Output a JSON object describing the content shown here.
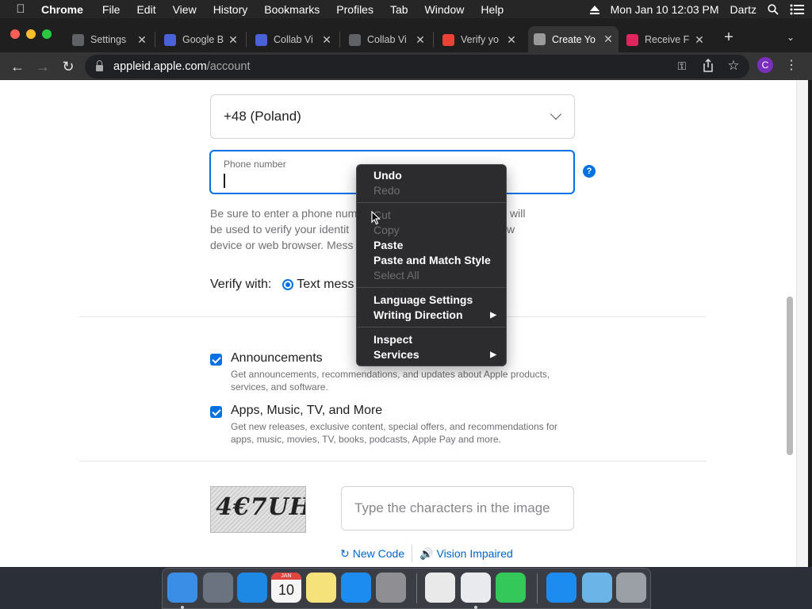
{
  "menubar": {
    "app": "Chrome",
    "items": [
      "File",
      "Edit",
      "View",
      "History",
      "Bookmarks",
      "Profiles",
      "Tab",
      "Window",
      "Help"
    ],
    "datetime": "Mon Jan 10  12:03 PM",
    "user": "Dartz"
  },
  "tabs": [
    {
      "title": "Settings",
      "icon": "gear-icon",
      "color": "#5f6368"
    },
    {
      "title": "Google B",
      "icon": "google-forms-icon",
      "color": "#4a62d8"
    },
    {
      "title": "Collab Vi",
      "icon": "google-forms-icon",
      "color": "#4a62d8"
    },
    {
      "title": "Collab Vi",
      "icon": "globe-icon",
      "color": "#5f6368"
    },
    {
      "title": "Verify yo",
      "icon": "gmail-icon",
      "color": "#ea4335"
    },
    {
      "title": "Create Yo",
      "icon": "apple-icon",
      "color": "#9a9a9a",
      "active": true
    },
    {
      "title": "Receive F",
      "icon": "receive-sms-icon",
      "color": "#e0245e"
    }
  ],
  "address": {
    "domain": "appleid.apple.com",
    "path": "/account"
  },
  "profile_initial": "C",
  "form": {
    "country": "+48 (Poland)",
    "phone_label": "Phone number",
    "help": "?",
    "hint_parts": [
      "Be sure to enter a phone num",
      "will",
      "be used to verify your identit",
      "w",
      "device or web browser. Mess"
    ],
    "verify_label": "Verify with:",
    "verify_option": "Text mess"
  },
  "options": [
    {
      "title": "Announcements",
      "desc": "Get announcements, recommendations, and updates about Apple products, services, and software.",
      "checked": true
    },
    {
      "title": "Apps, Music, TV, and More",
      "desc": "Get new releases, exclusive content, special offers, and recommendations for apps, music, movies, TV, books, podcasts, Apple Pay and more.",
      "checked": true
    }
  ],
  "captcha": {
    "image_text": "4€7UH",
    "placeholder": "Type the characters in the image",
    "new_code": "New Code",
    "vision_impaired": "Vision Impaired"
  },
  "context_menu": {
    "groups": [
      [
        {
          "label": "Undo",
          "enabled": true
        },
        {
          "label": "Redo",
          "enabled": false
        }
      ],
      [
        {
          "label": "Cut",
          "enabled": false
        },
        {
          "label": "Copy",
          "enabled": false
        },
        {
          "label": "Paste",
          "enabled": true
        },
        {
          "label": "Paste and Match Style",
          "enabled": true
        },
        {
          "label": "Select All",
          "enabled": false
        }
      ],
      [
        {
          "label": "Language Settings",
          "enabled": true
        },
        {
          "label": "Writing Direction",
          "enabled": true,
          "submenu": true
        }
      ],
      [
        {
          "label": "Inspect",
          "enabled": true
        },
        {
          "label": "Services",
          "enabled": true,
          "submenu": true
        }
      ]
    ]
  },
  "dock": [
    {
      "name": "finder-icon",
      "color": "#3a8ee6",
      "running": true
    },
    {
      "name": "launchpad-icon",
      "color": "#6b7280"
    },
    {
      "name": "safari-icon",
      "color": "#1e88e5"
    },
    {
      "name": "calendar-icon",
      "color": "#f5f5f5",
      "text": "10",
      "sub": "JAN"
    },
    {
      "name": "notes-icon",
      "color": "#f6e27a"
    },
    {
      "name": "app-store-icon",
      "color": "#1c8cf0"
    },
    {
      "name": "system-preferences-icon",
      "color": "#8e8e93"
    },
    {
      "name": "preview-icon",
      "color": "#e9e9e9"
    },
    {
      "name": "chrome-icon",
      "color": "#e8eaed",
      "running": true
    },
    {
      "name": "facetime-icon",
      "color": "#34c759"
    },
    {
      "name": "app-store-downloads-icon",
      "color": "#1c8cf0"
    },
    {
      "name": "folder-icon",
      "color": "#6ab4e8"
    },
    {
      "name": "trash-icon",
      "color": "#9aa0a6"
    }
  ]
}
